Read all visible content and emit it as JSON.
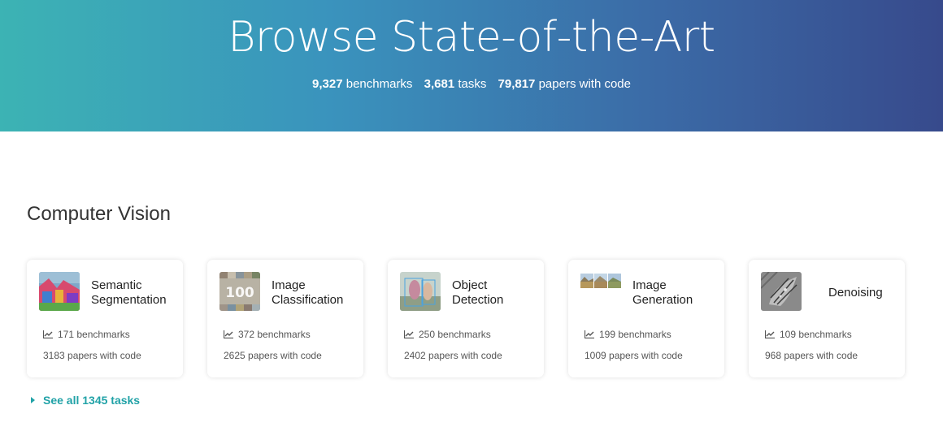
{
  "hero": {
    "title": "Browse State-of-the-Art",
    "stats": [
      {
        "value": "9,327",
        "label": "benchmarks"
      },
      {
        "value": "3,681",
        "label": "tasks"
      },
      {
        "value": "79,817",
        "label": "papers with code"
      }
    ]
  },
  "section": {
    "title": "Computer Vision",
    "see_all": "See all 1345 tasks"
  },
  "cards": [
    {
      "title_line1": "Semantic",
      "title_line2": "Segmentation",
      "benchmarks": "171 benchmarks",
      "papers": "3183 papers with code"
    },
    {
      "title_line1": "Image",
      "title_line2": "Classification",
      "benchmarks": "372 benchmarks",
      "papers": "2625 papers with code"
    },
    {
      "title_line1": "Object",
      "title_line2": "Detection",
      "benchmarks": "250 benchmarks",
      "papers": "2402 papers with code"
    },
    {
      "title_line1": "Image",
      "title_line2": "Generation",
      "benchmarks": "199 benchmarks",
      "papers": "1009 papers with code"
    },
    {
      "title_line1": "Denoising",
      "title_line2": "",
      "benchmarks": "109 benchmarks",
      "papers": "968 papers with code"
    }
  ],
  "colors": {
    "accent": "#21a2a7",
    "hero_start": "#3cb3b4",
    "hero_end": "#374a8c"
  }
}
